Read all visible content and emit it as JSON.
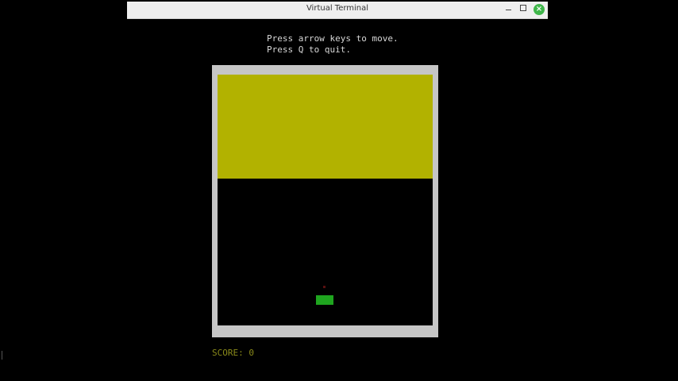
{
  "window": {
    "title": "Virtual Terminal",
    "controls": {
      "minimize_icon": "minimize-icon",
      "maximize_icon": "maximize-icon",
      "close_icon": "close-icon"
    }
  },
  "terminal": {
    "instructions_line1": "Press arrow keys to move.",
    "instructions_line2": "Press Q to quit.",
    "score_text": "SCORE: 0"
  },
  "colors": {
    "arena_border": "#c6c6c6",
    "block": "#b2b200",
    "player": "#1fa51f",
    "score_text": "#8a8a1a",
    "close_button": "#3fb64a"
  }
}
